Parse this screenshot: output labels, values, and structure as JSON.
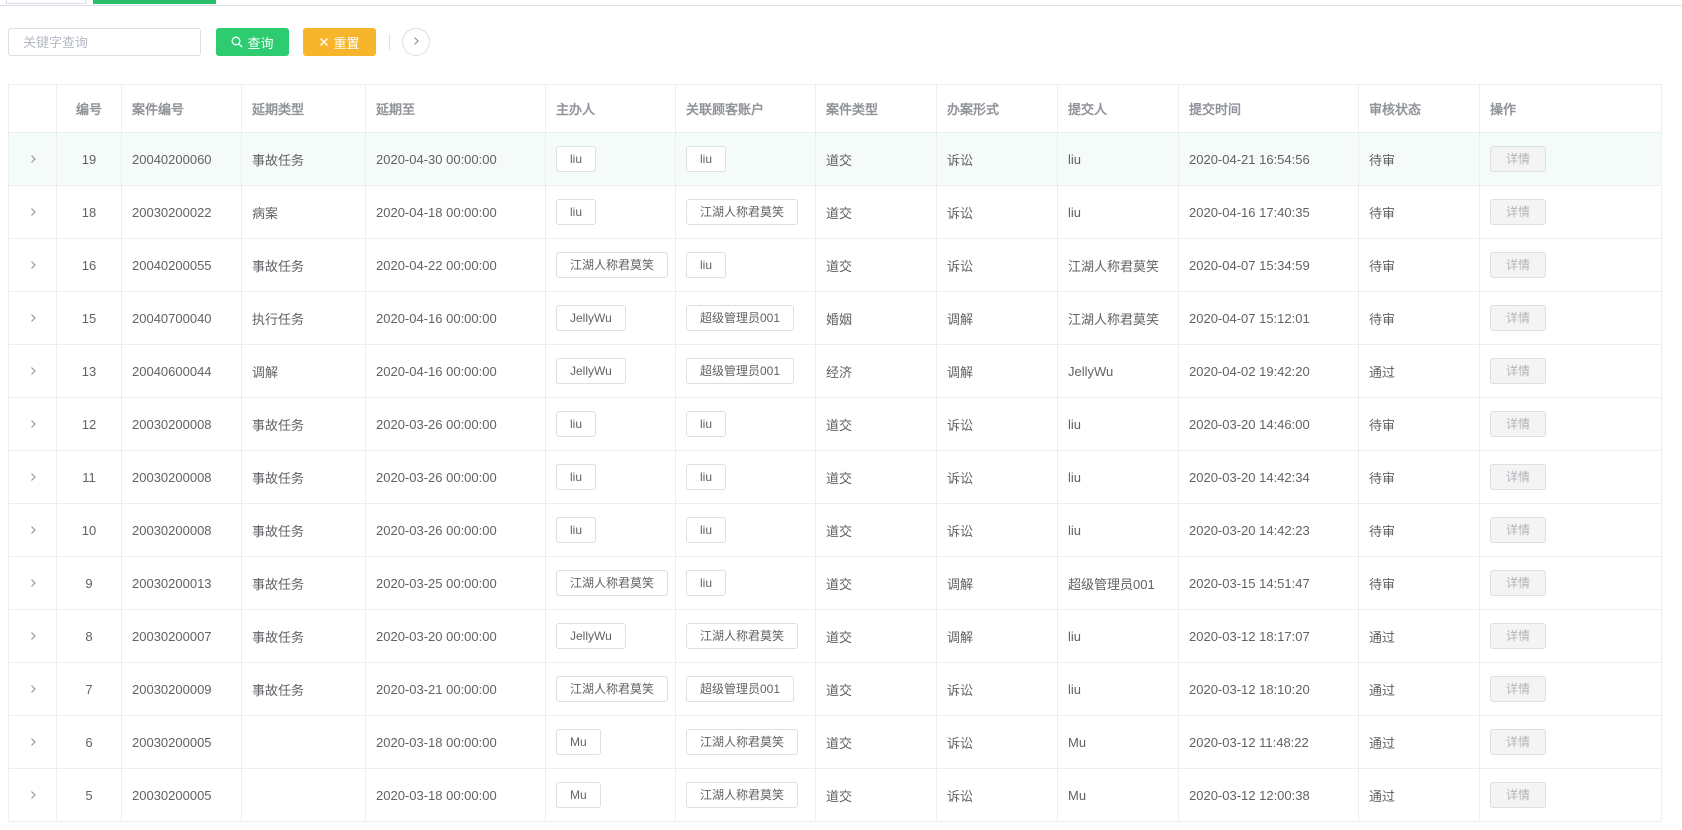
{
  "toolbar": {
    "search_placeholder": "关键字查询",
    "query_label": "查询",
    "reset_label": "重置"
  },
  "table": {
    "headers": [
      "",
      "编号",
      "案件编号",
      "延期类型",
      "延期至",
      "主办人",
      "关联顾客账户",
      "案件类型",
      "办案形式",
      "提交人",
      "提交时间",
      "审核状态",
      "操作"
    ],
    "action_label": "详情",
    "rows": [
      {
        "id": "19",
        "case_no": "20040200060",
        "delay_type": "事故任务",
        "delay_to": "2020-04-30 00:00:00",
        "host": "liu",
        "customer": "liu",
        "case_type": "道交",
        "mode": "诉讼",
        "submitter": "liu",
        "submit_time": "2020-04-21 16:54:56",
        "status": "待审"
      },
      {
        "id": "18",
        "case_no": "20030200022",
        "delay_type": "病案",
        "delay_to": "2020-04-18 00:00:00",
        "host": "liu",
        "customer": "江湖人称君莫笑",
        "case_type": "道交",
        "mode": "诉讼",
        "submitter": "liu",
        "submit_time": "2020-04-16 17:40:35",
        "status": "待审"
      },
      {
        "id": "16",
        "case_no": "20040200055",
        "delay_type": "事故任务",
        "delay_to": "2020-04-22 00:00:00",
        "host": "江湖人称君莫笑",
        "customer": "liu",
        "case_type": "道交",
        "mode": "诉讼",
        "submitter": "江湖人称君莫笑",
        "submit_time": "2020-04-07 15:34:59",
        "status": "待审"
      },
      {
        "id": "15",
        "case_no": "20040700040",
        "delay_type": "执行任务",
        "delay_to": "2020-04-16 00:00:00",
        "host": "JellyWu",
        "customer": "超级管理员001",
        "case_type": "婚姻",
        "mode": "调解",
        "submitter": "江湖人称君莫笑",
        "submit_time": "2020-04-07 15:12:01",
        "status": "待审"
      },
      {
        "id": "13",
        "case_no": "20040600044",
        "delay_type": "调解",
        "delay_to": "2020-04-16 00:00:00",
        "host": "JellyWu",
        "customer": "超级管理员001",
        "case_type": "经济",
        "mode": "调解",
        "submitter": "JellyWu",
        "submit_time": "2020-04-02 19:42:20",
        "status": "通过"
      },
      {
        "id": "12",
        "case_no": "20030200008",
        "delay_type": "事故任务",
        "delay_to": "2020-03-26 00:00:00",
        "host": "liu",
        "customer": "liu",
        "case_type": "道交",
        "mode": "诉讼",
        "submitter": "liu",
        "submit_time": "2020-03-20 14:46:00",
        "status": "待审"
      },
      {
        "id": "11",
        "case_no": "20030200008",
        "delay_type": "事故任务",
        "delay_to": "2020-03-26 00:00:00",
        "host": "liu",
        "customer": "liu",
        "case_type": "道交",
        "mode": "诉讼",
        "submitter": "liu",
        "submit_time": "2020-03-20 14:42:34",
        "status": "待审"
      },
      {
        "id": "10",
        "case_no": "20030200008",
        "delay_type": "事故任务",
        "delay_to": "2020-03-26 00:00:00",
        "host": "liu",
        "customer": "liu",
        "case_type": "道交",
        "mode": "诉讼",
        "submitter": "liu",
        "submit_time": "2020-03-20 14:42:23",
        "status": "待审"
      },
      {
        "id": "9",
        "case_no": "20030200013",
        "delay_type": "事故任务",
        "delay_to": "2020-03-25 00:00:00",
        "host": "江湖人称君莫笑",
        "customer": "liu",
        "case_type": "道交",
        "mode": "调解",
        "submitter": "超级管理员001",
        "submit_time": "2020-03-15 14:51:47",
        "status": "待审"
      },
      {
        "id": "8",
        "case_no": "20030200007",
        "delay_type": "事故任务",
        "delay_to": "2020-03-20 00:00:00",
        "host": "JellyWu",
        "customer": "江湖人称君莫笑",
        "case_type": "道交",
        "mode": "调解",
        "submitter": "liu",
        "submit_time": "2020-03-12 18:17:07",
        "status": "通过"
      },
      {
        "id": "7",
        "case_no": "20030200009",
        "delay_type": "事故任务",
        "delay_to": "2020-03-21 00:00:00",
        "host": "江湖人称君莫笑",
        "customer": "超级管理员001",
        "case_type": "道交",
        "mode": "诉讼",
        "submitter": "liu",
        "submit_time": "2020-03-12 18:10:20",
        "status": "通过"
      },
      {
        "id": "6",
        "case_no": "20030200005",
        "delay_type": "",
        "delay_to": "2020-03-18 00:00:00",
        "host": "Mu",
        "customer": "江湖人称君莫笑",
        "case_type": "道交",
        "mode": "诉讼",
        "submitter": "Mu",
        "submit_time": "2020-03-12 11:48:22",
        "status": "通过"
      },
      {
        "id": "5",
        "case_no": "20030200005",
        "delay_type": "",
        "delay_to": "2020-03-18 00:00:00",
        "host": "Mu",
        "customer": "江湖人称君莫笑",
        "case_type": "道交",
        "mode": "诉讼",
        "submitter": "Mu",
        "submit_time": "2020-03-12 12:00:38",
        "status": "通过"
      }
    ]
  },
  "icons": {
    "query": "search-icon",
    "reset": "close-icon",
    "collapse": "chevron-right-icon",
    "expand_row": "chevron-right-icon"
  },
  "colors": {
    "primary": "#2ecc71",
    "warning": "#f7b52c",
    "header_text": "#909399",
    "body_text": "#606266"
  }
}
